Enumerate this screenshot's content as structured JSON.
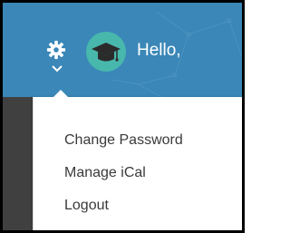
{
  "header": {
    "greeting": "Hello,",
    "settings_icon": "gear-icon",
    "dropdown_icon": "chevron-down-icon",
    "avatar_icon": "graduation-cap-icon",
    "colors": {
      "bar": "#3a87b8",
      "avatar_bg": "#48b8ad",
      "text": "#ffffff"
    }
  },
  "menu": {
    "items": [
      {
        "label": "Change Password"
      },
      {
        "label": "Manage iCal"
      },
      {
        "label": "Logout"
      }
    ],
    "text_color": "#3a3a3a"
  }
}
